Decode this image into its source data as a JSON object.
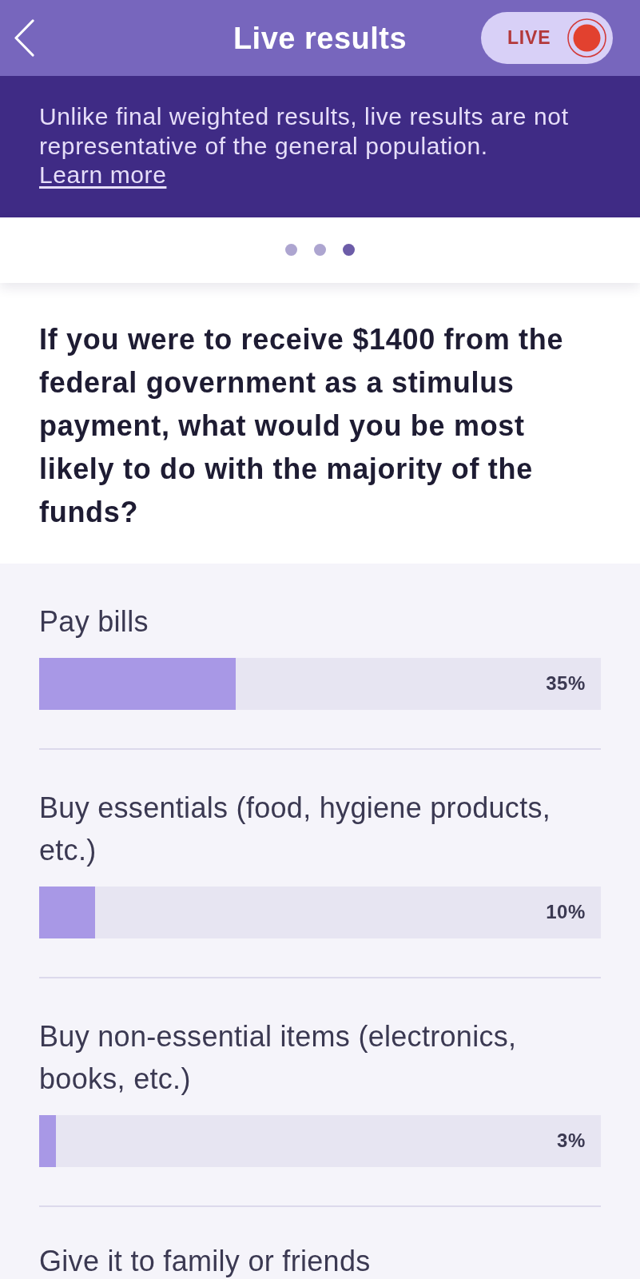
{
  "header": {
    "title": "Live results",
    "live_badge": {
      "label": "LIVE"
    }
  },
  "notice": {
    "text": "Unlike final weighted results, live results are not representative of the general population.",
    "link": "Learn more"
  },
  "pages": [
    {
      "selected": false
    },
    {
      "selected": false
    },
    {
      "selected": true
    }
  ],
  "question": "If you were to receive $1400 from the federal government as a stimulus payment, what would you be most likely to do with the majority of the funds?",
  "results": [
    {
      "label": "Pay bills",
      "level": 0.35,
      "reading": "35%"
    },
    {
      "label": "Buy essentials (food, hygiene products, etc.)",
      "level": 0.1,
      "reading": "10%"
    },
    {
      "label": "Buy non-essential items (electronics, books, etc.)",
      "level": 0.03,
      "reading": "3%"
    },
    {
      "label": "Give it to family or friends"
    }
  ]
}
